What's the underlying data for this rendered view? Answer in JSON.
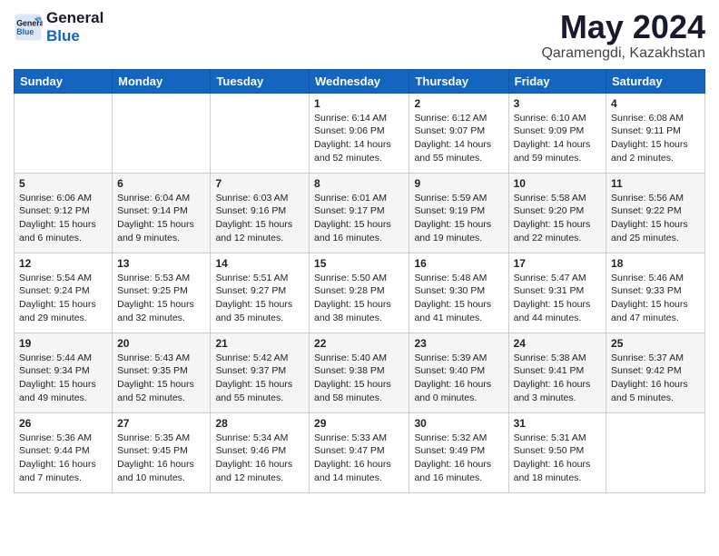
{
  "header": {
    "logo_line1": "General",
    "logo_line2": "Blue",
    "month_year": "May 2024",
    "location": "Qaramengdi, Kazakhstan"
  },
  "weekdays": [
    "Sunday",
    "Monday",
    "Tuesday",
    "Wednesday",
    "Thursday",
    "Friday",
    "Saturday"
  ],
  "weeks": [
    [
      {
        "day": "",
        "info": ""
      },
      {
        "day": "",
        "info": ""
      },
      {
        "day": "",
        "info": ""
      },
      {
        "day": "1",
        "info": "Sunrise: 6:14 AM\nSunset: 9:06 PM\nDaylight: 14 hours and 52 minutes."
      },
      {
        "day": "2",
        "info": "Sunrise: 6:12 AM\nSunset: 9:07 PM\nDaylight: 14 hours and 55 minutes."
      },
      {
        "day": "3",
        "info": "Sunrise: 6:10 AM\nSunset: 9:09 PM\nDaylight: 14 hours and 59 minutes."
      },
      {
        "day": "4",
        "info": "Sunrise: 6:08 AM\nSunset: 9:11 PM\nDaylight: 15 hours and 2 minutes."
      }
    ],
    [
      {
        "day": "5",
        "info": "Sunrise: 6:06 AM\nSunset: 9:12 PM\nDaylight: 15 hours and 6 minutes."
      },
      {
        "day": "6",
        "info": "Sunrise: 6:04 AM\nSunset: 9:14 PM\nDaylight: 15 hours and 9 minutes."
      },
      {
        "day": "7",
        "info": "Sunrise: 6:03 AM\nSunset: 9:16 PM\nDaylight: 15 hours and 12 minutes."
      },
      {
        "day": "8",
        "info": "Sunrise: 6:01 AM\nSunset: 9:17 PM\nDaylight: 15 hours and 16 minutes."
      },
      {
        "day": "9",
        "info": "Sunrise: 5:59 AM\nSunset: 9:19 PM\nDaylight: 15 hours and 19 minutes."
      },
      {
        "day": "10",
        "info": "Sunrise: 5:58 AM\nSunset: 9:20 PM\nDaylight: 15 hours and 22 minutes."
      },
      {
        "day": "11",
        "info": "Sunrise: 5:56 AM\nSunset: 9:22 PM\nDaylight: 15 hours and 25 minutes."
      }
    ],
    [
      {
        "day": "12",
        "info": "Sunrise: 5:54 AM\nSunset: 9:24 PM\nDaylight: 15 hours and 29 minutes."
      },
      {
        "day": "13",
        "info": "Sunrise: 5:53 AM\nSunset: 9:25 PM\nDaylight: 15 hours and 32 minutes."
      },
      {
        "day": "14",
        "info": "Sunrise: 5:51 AM\nSunset: 9:27 PM\nDaylight: 15 hours and 35 minutes."
      },
      {
        "day": "15",
        "info": "Sunrise: 5:50 AM\nSunset: 9:28 PM\nDaylight: 15 hours and 38 minutes."
      },
      {
        "day": "16",
        "info": "Sunrise: 5:48 AM\nSunset: 9:30 PM\nDaylight: 15 hours and 41 minutes."
      },
      {
        "day": "17",
        "info": "Sunrise: 5:47 AM\nSunset: 9:31 PM\nDaylight: 15 hours and 44 minutes."
      },
      {
        "day": "18",
        "info": "Sunrise: 5:46 AM\nSunset: 9:33 PM\nDaylight: 15 hours and 47 minutes."
      }
    ],
    [
      {
        "day": "19",
        "info": "Sunrise: 5:44 AM\nSunset: 9:34 PM\nDaylight: 15 hours and 49 minutes."
      },
      {
        "day": "20",
        "info": "Sunrise: 5:43 AM\nSunset: 9:35 PM\nDaylight: 15 hours and 52 minutes."
      },
      {
        "day": "21",
        "info": "Sunrise: 5:42 AM\nSunset: 9:37 PM\nDaylight: 15 hours and 55 minutes."
      },
      {
        "day": "22",
        "info": "Sunrise: 5:40 AM\nSunset: 9:38 PM\nDaylight: 15 hours and 58 minutes."
      },
      {
        "day": "23",
        "info": "Sunrise: 5:39 AM\nSunset: 9:40 PM\nDaylight: 16 hours and 0 minutes."
      },
      {
        "day": "24",
        "info": "Sunrise: 5:38 AM\nSunset: 9:41 PM\nDaylight: 16 hours and 3 minutes."
      },
      {
        "day": "25",
        "info": "Sunrise: 5:37 AM\nSunset: 9:42 PM\nDaylight: 16 hours and 5 minutes."
      }
    ],
    [
      {
        "day": "26",
        "info": "Sunrise: 5:36 AM\nSunset: 9:44 PM\nDaylight: 16 hours and 7 minutes."
      },
      {
        "day": "27",
        "info": "Sunrise: 5:35 AM\nSunset: 9:45 PM\nDaylight: 16 hours and 10 minutes."
      },
      {
        "day": "28",
        "info": "Sunrise: 5:34 AM\nSunset: 9:46 PM\nDaylight: 16 hours and 12 minutes."
      },
      {
        "day": "29",
        "info": "Sunrise: 5:33 AM\nSunset: 9:47 PM\nDaylight: 16 hours and 14 minutes."
      },
      {
        "day": "30",
        "info": "Sunrise: 5:32 AM\nSunset: 9:49 PM\nDaylight: 16 hours and 16 minutes."
      },
      {
        "day": "31",
        "info": "Sunrise: 5:31 AM\nSunset: 9:50 PM\nDaylight: 16 hours and 18 minutes."
      },
      {
        "day": "",
        "info": ""
      }
    ]
  ]
}
